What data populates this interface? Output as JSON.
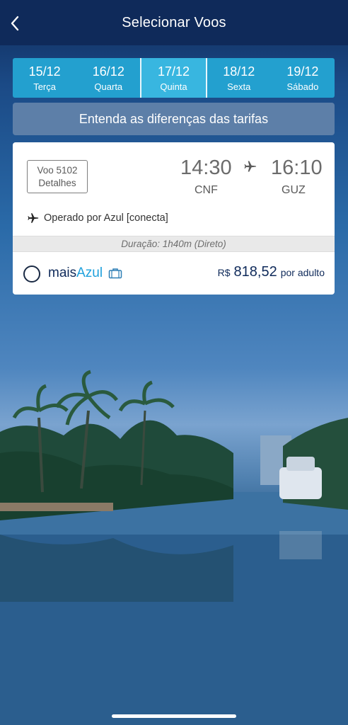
{
  "header": {
    "title": "Selecionar Voos"
  },
  "dates": [
    {
      "date": "15/12",
      "weekday": "Terça",
      "selected": false
    },
    {
      "date": "16/12",
      "weekday": "Quarta",
      "selected": false
    },
    {
      "date": "17/12",
      "weekday": "Quinta",
      "selected": true
    },
    {
      "date": "18/12",
      "weekday": "Sexta",
      "selected": false
    },
    {
      "date": "19/12",
      "weekday": "Sábado",
      "selected": false
    }
  ],
  "fare_info_button": "Entenda as diferenças das tarifas",
  "flight": {
    "number": "Voo 5102",
    "details_label": "Detalhes",
    "departure_time": "14:30",
    "arrival_time": "16:10",
    "origin": "CNF",
    "destination": "GUZ",
    "operated_by": "Operado por Azul [conecta]",
    "duration": "Duração: 1h40m (Direto)",
    "fare": {
      "brand_prefix": "mais",
      "brand_suffix": "Azul",
      "currency": "R$",
      "price": "818,52",
      "per": "por adulto"
    }
  },
  "colors": {
    "nav": "#0f2a5a",
    "dates_bar": "#23a0cf",
    "selected_date": "#38b6e0",
    "accent_blue": "#1ea0dc"
  }
}
